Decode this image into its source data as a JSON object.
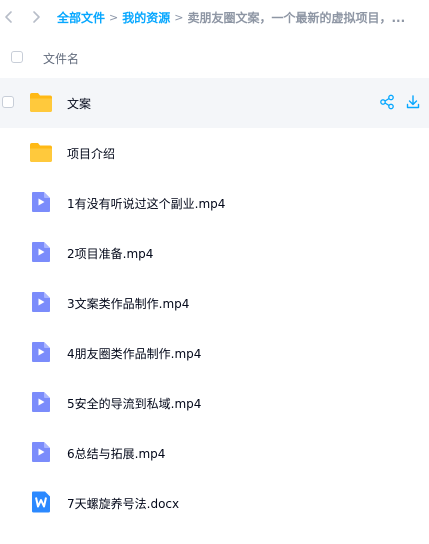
{
  "breadcrumb": {
    "root": "全部文件",
    "parent": "我的资源",
    "current": "卖朋友圈文案，一个最新的虚拟项目，..."
  },
  "list_header": {
    "column_label": "文件名"
  },
  "files": [
    {
      "name": "文案",
      "type": "folder-icon",
      "selected": true
    },
    {
      "name": "项目介绍",
      "type": "folder-icon"
    },
    {
      "name": "1有没有听说过这个副业.mp4",
      "type": "video-file-icon"
    },
    {
      "name": "2项目准备.mp4",
      "type": "video-file-icon"
    },
    {
      "name": "3文案类作品制作.mp4",
      "type": "video-file-icon"
    },
    {
      "name": "4朋友圈类作品制作.mp4",
      "type": "video-file-icon"
    },
    {
      "name": "5安全的导流到私域.mp4",
      "type": "video-file-icon"
    },
    {
      "name": "6总结与拓展.mp4",
      "type": "video-file-icon"
    },
    {
      "name": "7天螺旋养号法.docx",
      "type": "word-file-icon"
    }
  ],
  "icons": {
    "back": "chevron-left-icon",
    "forward": "chevron-right-icon",
    "share": "share-icon",
    "download": "download-icon"
  },
  "colors": {
    "accent": "#06a7ff",
    "folder": "#ffc128",
    "video": "#7b8cfb",
    "word": "#2b89ff",
    "selected_row": "#f4f6f9"
  }
}
